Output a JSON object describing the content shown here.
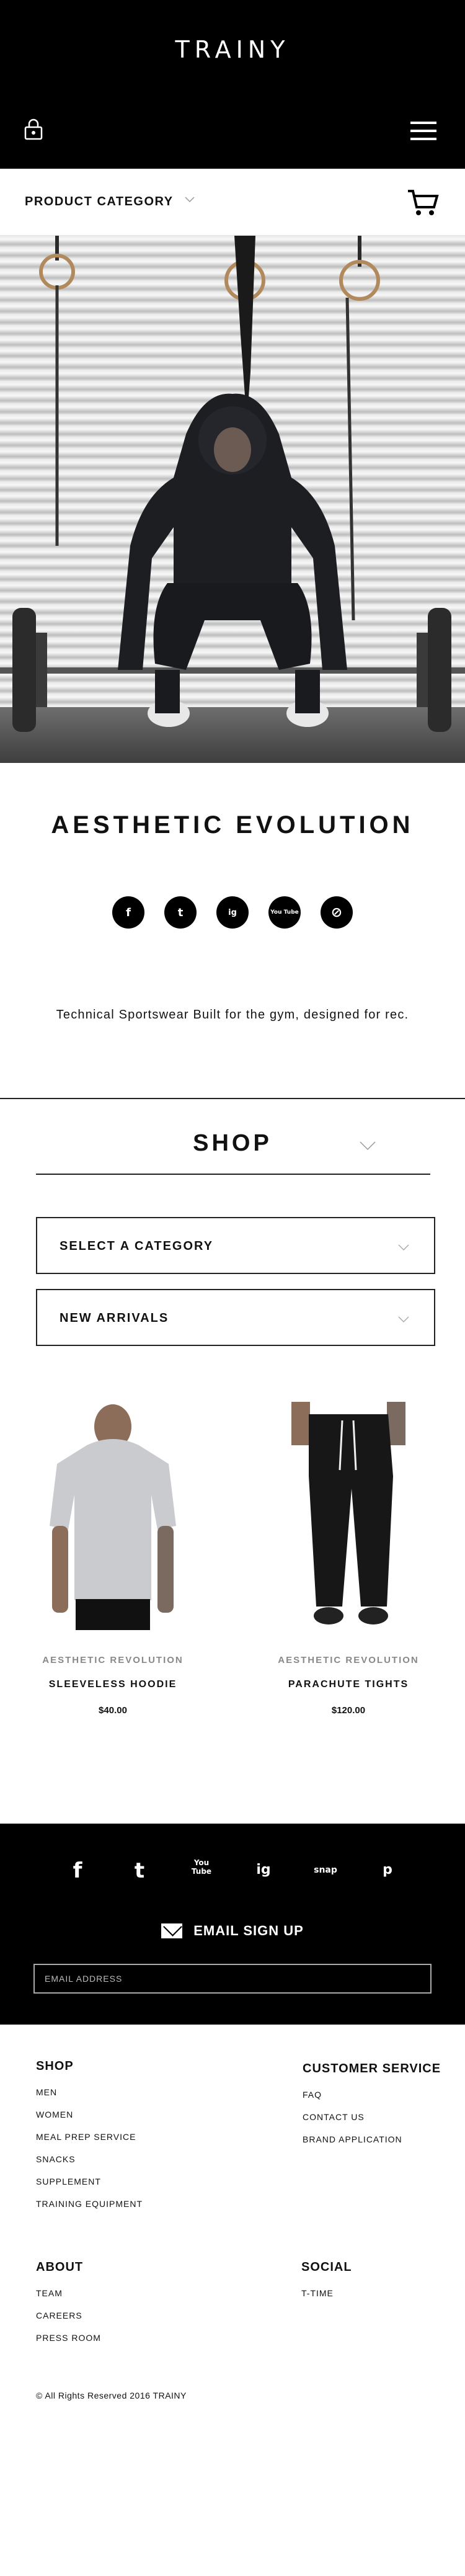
{
  "header": {
    "logo": "TRAINY"
  },
  "category_bar": {
    "label": "PRODUCT CATEGORY"
  },
  "hero": {
    "brand": "AESTHETIC EVOLUTION",
    "social": [
      "f",
      "t",
      "ig",
      "You Tube",
      "⊘"
    ],
    "tagline": "Technical Sportswear Built for the gym, designed for rec."
  },
  "shop": {
    "title": "SHOP",
    "select_category": "SELECT A CATEGORY",
    "new_arrivals": "NEW ARRIVALS",
    "products": [
      {
        "brand": "AESTHETIC REVOLUTION",
        "name": "SLEEVELESS HOODIE",
        "price": "$40.00"
      },
      {
        "brand": "AESTHETIC REVOLUTION",
        "name": "PARACHUTE  TIGHTS",
        "price": "$120.00"
      }
    ]
  },
  "footer": {
    "social": [
      "f",
      "t",
      "You Tube",
      "ig",
      "snap",
      "p"
    ],
    "email_signup": "EMAIL SIGN UP",
    "email_placeholder": "EMAIL ADDRESS",
    "shop": {
      "title": "SHOP",
      "links": [
        "MEN",
        "WOMEN",
        "MEAL PREP SERVICE",
        "SNACKS",
        "SUPPLEMENT",
        "TRAINING EQUIPMENT"
      ]
    },
    "customer_service": {
      "title": "CUSTOMER SERVICE",
      "links": [
        "FAQ",
        "CONTACT US",
        "BRAND APPLICATION"
      ]
    },
    "about": {
      "title": "ABOUT",
      "links": [
        "TEAM",
        "CAREERS",
        "PRESS ROOM"
      ]
    },
    "social_col": {
      "title": "SOCIAL",
      "links": [
        "T-TIME"
      ]
    },
    "copyright": "© All Rights Reserved 2016 TRAINY"
  }
}
